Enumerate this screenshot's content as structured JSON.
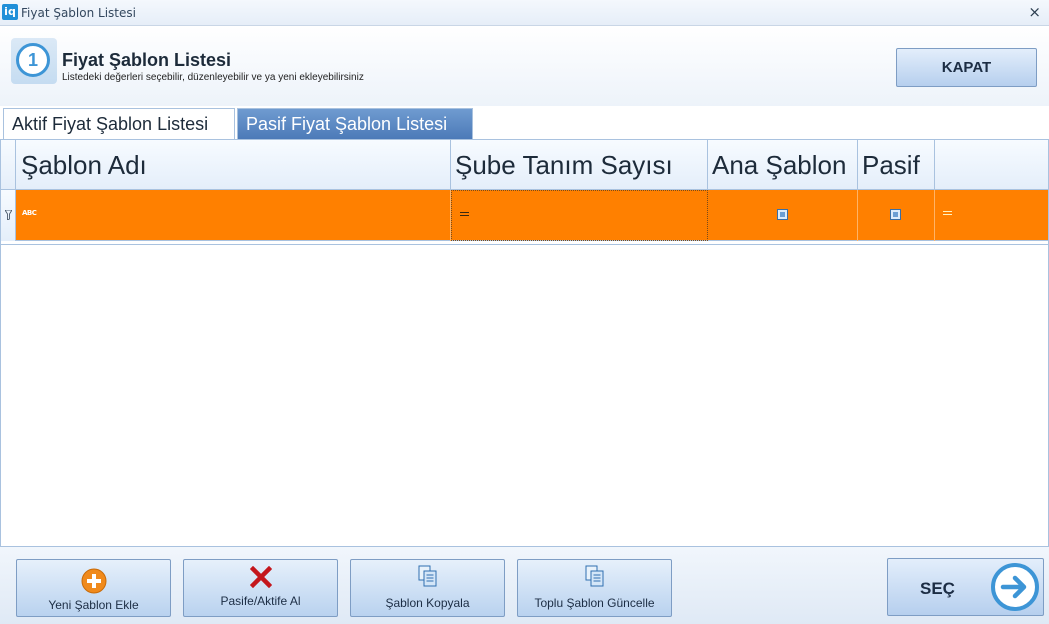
{
  "window": {
    "app_icon": "iq",
    "title": "Fiyat Şablon Listesi",
    "close_glyph": "×"
  },
  "header": {
    "step_number": "1",
    "title": "Fiyat Şablon Listesi",
    "subtitle": "Listedeki değerleri seçebilir, düzenleyebilir ve ya yeni ekleyebilirsiniz",
    "close_label": "KAPAT"
  },
  "tabs": [
    {
      "label": "Aktif Fiyat Şablon Listesi",
      "active": true
    },
    {
      "label": "Pasif Fiyat Şablon Listesi",
      "active": false
    }
  ],
  "grid": {
    "columns": [
      "Şablon Adı",
      "Şube Tanım Sayısı",
      "Ana Şablon",
      "Pasif",
      ""
    ],
    "filter_row": {
      "color": "#ff8000",
      "abc_glyph": "ABC",
      "icons": [
        "funnel-icon",
        "abc-icon",
        "equals-icon",
        "checkbox-icon",
        "checkbox-icon",
        "equals-icon"
      ]
    },
    "rows": []
  },
  "toolbar": {
    "buttons": [
      {
        "label": "Yeni Şablon Ekle",
        "icon": "add-circle-icon"
      },
      {
        "label": "Pasife/Aktife Al",
        "icon": "red-x-icon"
      },
      {
        "label": "Şablon Kopyala",
        "icon": "copy-document-icon"
      },
      {
        "label": "Toplu Şablon Güncelle",
        "icon": "copy-document-icon"
      }
    ],
    "select_label": "SEÇ",
    "select_icon": "arrow-right-circle-icon"
  },
  "colors": {
    "accent": "#3d95d6",
    "filter_row": "#ff8000",
    "tab_inactive": "#4c7ab8"
  }
}
